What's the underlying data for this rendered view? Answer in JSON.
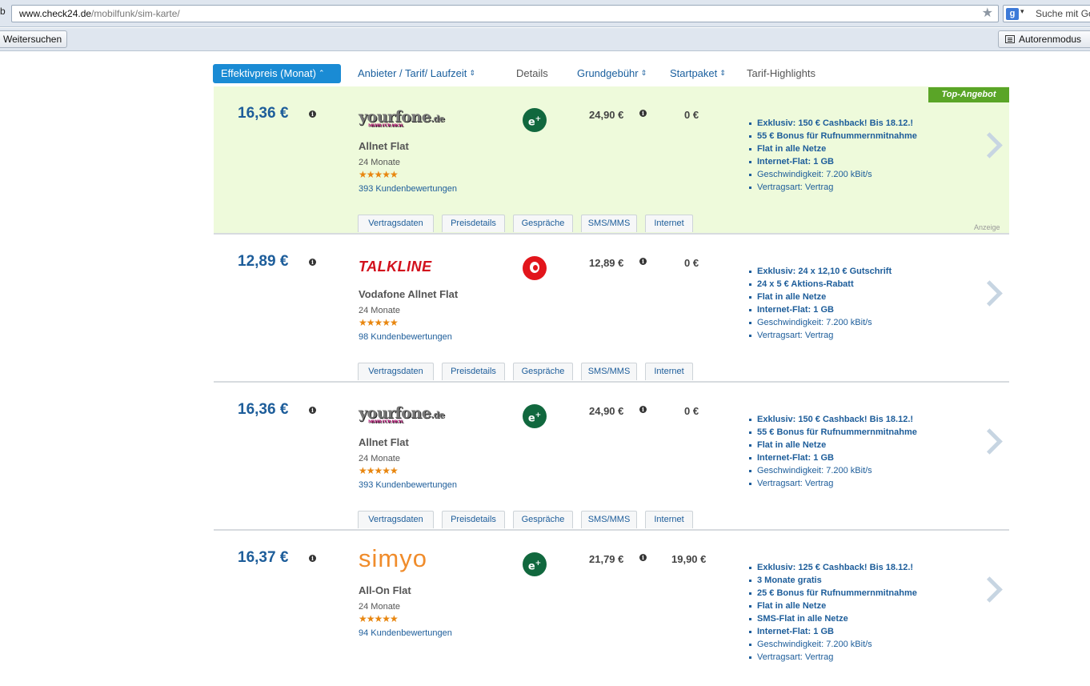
{
  "browser": {
    "tab_fragment": "b",
    "url_host": "www.check24.de",
    "url_path": "/mobilfunk/sim-karte/",
    "search_placeholder": "Suche mit Go",
    "search_engine_icon": "google-icon",
    "toolbar": {
      "weitersuchen_label": "Weitersuchen",
      "autorenmodus_label": "Autorenmodus"
    }
  },
  "sort_header": {
    "items": [
      {
        "label": "Effektivpreis (Monat)",
        "active": true
      },
      {
        "label": "Anbieter / Tarif/ Laufzeit",
        "active": false
      },
      {
        "label": "Details",
        "active": false
      },
      {
        "label": "Grundgebühr",
        "active": false
      },
      {
        "label": "Startpaket",
        "active": false
      },
      {
        "label": "Tarif-Highlights",
        "active": false
      }
    ]
  },
  "offers": [
    {
      "price": "16,36 €",
      "provider_logo": "yourfone.de",
      "provider_logo_sub": "MEHR FÜR DICH.",
      "tariff": "Allnet Flat",
      "duration": "24 Monate",
      "stars": "★★★★★",
      "reviews": "393 Kundenbewertungen",
      "network": "e+",
      "base_fee": "24,90 €",
      "start_fee": "0 €",
      "highlights": [
        {
          "text": "Exklusiv: 150 € Cashback! Bis 18.12.!",
          "bold": true
        },
        {
          "text": "55 € Bonus für Rufnummernmitnahme",
          "bold": true
        },
        {
          "text": "Flat in alle Netze",
          "bold": true
        },
        {
          "text": "Internet-Flat: 1 GB",
          "bold": true
        },
        {
          "text": "Geschwindigkeit: 7.200 kBit/s",
          "bold": false
        },
        {
          "text": "Vertragsart: Vertrag",
          "bold": false
        }
      ],
      "ribbon": "Top-Angebot",
      "ad_label": "Anzeige"
    },
    {
      "price": "12,89 €",
      "provider_logo": "TALKLINE",
      "tariff": "Vodafone Allnet Flat",
      "duration": "24 Monate",
      "stars": "★★★★★",
      "reviews": "98 Kundenbewertungen",
      "network": "vodafone",
      "base_fee": "12,89 €",
      "start_fee": "0 €",
      "highlights": [
        {
          "text": "Exklusiv: 24 x 12,10 € Gutschrift",
          "bold": true
        },
        {
          "text": "24 x 5 € Aktions-Rabatt",
          "bold": true
        },
        {
          "text": "Flat in alle Netze",
          "bold": true
        },
        {
          "text": "Internet-Flat: 1 GB",
          "bold": true
        },
        {
          "text": "Geschwindigkeit: 7.200 kBit/s",
          "bold": false
        },
        {
          "text": "Vertragsart: Vertrag",
          "bold": false
        }
      ]
    },
    {
      "price": "16,36 €",
      "provider_logo": "yourfone.de",
      "provider_logo_sub": "MEHR FÜR DICH.",
      "tariff": "Allnet Flat",
      "duration": "24 Monate",
      "stars": "★★★★★",
      "reviews": "393 Kundenbewertungen",
      "network": "e+",
      "base_fee": "24,90 €",
      "start_fee": "0 €",
      "highlights": [
        {
          "text": "Exklusiv: 150 € Cashback! Bis 18.12.!",
          "bold": true
        },
        {
          "text": "55 € Bonus für Rufnummernmitnahme",
          "bold": true
        },
        {
          "text": "Flat in alle Netze",
          "bold": true
        },
        {
          "text": "Internet-Flat: 1 GB",
          "bold": true
        },
        {
          "text": "Geschwindigkeit: 7.200 kBit/s",
          "bold": false
        },
        {
          "text": "Vertragsart: Vertrag",
          "bold": false
        }
      ]
    },
    {
      "price": "16,37 €",
      "provider_logo": "simyo",
      "tariff": "All-On Flat",
      "duration": "24 Monate",
      "stars": "★★★★★",
      "reviews": "94 Kundenbewertungen",
      "network": "e+",
      "base_fee": "21,79 €",
      "start_fee": "19,90 €",
      "highlights": [
        {
          "text": "Exklusiv: 125 € Cashback! Bis 18.12.!",
          "bold": true
        },
        {
          "text": "3 Monate gratis",
          "bold": true
        },
        {
          "text": "25 € Bonus für Rufnummernmitnahme",
          "bold": true
        },
        {
          "text": "Flat in alle Netze",
          "bold": true
        },
        {
          "text": "SMS-Flat in alle Netze",
          "bold": true
        },
        {
          "text": "Internet-Flat: 1 GB",
          "bold": true
        },
        {
          "text": "Geschwindigkeit: 7.200 kBit/s",
          "bold": false
        },
        {
          "text": "Vertragsart: Vertrag",
          "bold": false
        }
      ]
    }
  ],
  "detail_tabs": [
    "Vertragsdaten",
    "Preisdetails",
    "Gespräche",
    "SMS/MMS",
    "Internet"
  ],
  "colors": {
    "accent": "#1a8bd4",
    "price_blue": "#1d5d9a",
    "top_offer_bg": "#eefadb",
    "ribbon_green": "#5aa527",
    "eplus_green": "#11683e",
    "vodafone_red": "#e2151b",
    "talkline_red": "#d2101c",
    "simyo_orange": "#f08c2b",
    "star_orange": "#e8860f"
  }
}
